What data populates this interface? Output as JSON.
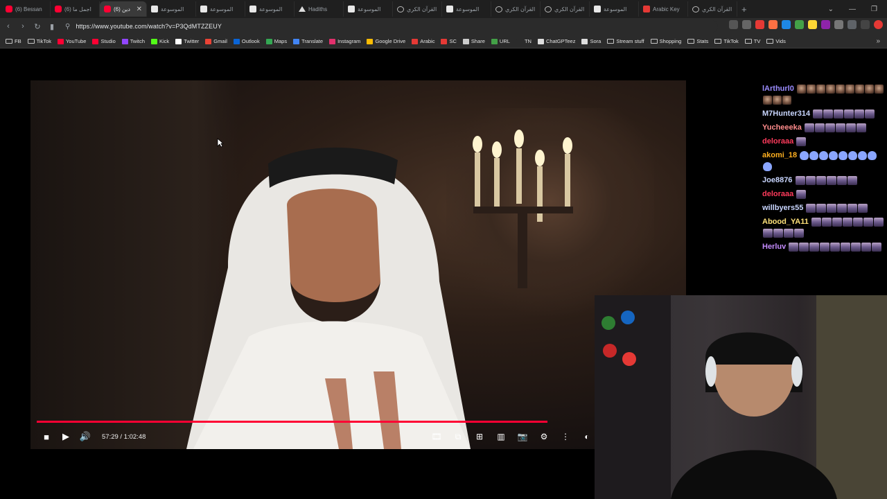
{
  "tabs": [
    {
      "label": "(6) Bessan",
      "icon": "youtube-icon"
    },
    {
      "label": "(6) اجمل ما",
      "icon": "youtube-icon"
    },
    {
      "label": "(6) دين",
      "icon": "youtube-icon",
      "active": true
    },
    {
      "label": "الموسوعة",
      "icon": "page-icon"
    },
    {
      "label": "الموسوعة",
      "icon": "page-icon"
    },
    {
      "label": "الموسوعة",
      "icon": "page-icon"
    },
    {
      "label": "Hadiths",
      "icon": "triangle-icon"
    },
    {
      "label": "الموسوعة",
      "icon": "page-icon"
    },
    {
      "label": "القرآن الكري",
      "icon": "globe-icon"
    },
    {
      "label": "الموسوعة",
      "icon": "page-icon"
    },
    {
      "label": "القرآن الكري",
      "icon": "globe-icon"
    },
    {
      "label": "القرآن الكري",
      "icon": "globe-icon"
    },
    {
      "label": "الموسوعة",
      "icon": "page-icon"
    },
    {
      "label": "Arabic Key",
      "icon": "arabic-icon"
    },
    {
      "label": "القرآن الكري",
      "icon": "globe-icon"
    }
  ],
  "new_tab": "+",
  "url": "https://www.youtube.com/watch?v=P3QdMTZZEUY",
  "bookmarks": [
    {
      "label": "FB",
      "icon": "folder-icon"
    },
    {
      "label": "TikTok",
      "icon": "folder-icon"
    },
    {
      "label": "YouTube",
      "icon": "youtube-icon",
      "color": "#ff0033"
    },
    {
      "label": "Studio",
      "icon": "youtube-studio-icon",
      "color": "#ff0033"
    },
    {
      "label": "Twitch",
      "icon": "twitch-icon",
      "color": "#9146ff"
    },
    {
      "label": "Kick",
      "icon": "kick-icon",
      "color": "#53fc18"
    },
    {
      "label": "Twitter",
      "icon": "x-icon",
      "color": "#ffffff"
    },
    {
      "label": "Gmail",
      "icon": "gmail-icon",
      "color": "#ea4335"
    },
    {
      "label": "Outlook",
      "icon": "outlook-icon",
      "color": "#0a64d6"
    },
    {
      "label": "Maps",
      "icon": "maps-icon",
      "color": "#34a853"
    },
    {
      "label": "Translate",
      "icon": "translate-icon",
      "color": "#4285f4"
    },
    {
      "label": "Instagram",
      "icon": "instagram-icon",
      "color": "#e1306c"
    },
    {
      "label": "Google Drive",
      "icon": "drive-icon",
      "color": "#fbbc04"
    },
    {
      "label": "Arabic",
      "icon": "arabic-icon",
      "color": "#e53935"
    },
    {
      "label": "SC",
      "icon": "sc-icon",
      "color": "#e53935"
    },
    {
      "label": "Share",
      "icon": "share-icon",
      "color": "#cccccc"
    },
    {
      "label": "URL",
      "icon": "url-icon",
      "color": "#43a047"
    },
    {
      "label": "TN",
      "icon": "none",
      "color": "#2b2b2b"
    },
    {
      "label": "ChatGPTeez",
      "icon": "chatgpt-icon",
      "color": "#dddddd"
    },
    {
      "label": "Sora",
      "icon": "sora-icon",
      "color": "#dddddd"
    },
    {
      "label": "Stream stuff",
      "icon": "folder-icon"
    },
    {
      "label": "Shopping",
      "icon": "folder-icon"
    },
    {
      "label": "Stats",
      "icon": "folder-icon"
    },
    {
      "label": "TikTok",
      "icon": "folder-icon"
    },
    {
      "label": "TV",
      "icon": "folder-icon"
    },
    {
      "label": "Vids",
      "icon": "folder-icon"
    }
  ],
  "player": {
    "time": "57:29 / 1:02:48",
    "progress": 0.915
  },
  "chat": [
    {
      "user": "lArthurl0",
      "color": "#9b8cff",
      "emotes": [
        "face",
        "face",
        "face",
        "face",
        "face",
        "face",
        "face",
        "face",
        "face",
        "face",
        "face",
        "face"
      ]
    },
    {
      "user": "M7Hunter314",
      "color": "#c9d6ff",
      "emotes": [
        "crowd",
        "crowd",
        "crowd",
        "crowd",
        "crowd",
        "crowd"
      ]
    },
    {
      "user": "Yucheeeka",
      "color": "#ff8c8c",
      "emotes": [
        "crowd",
        "crowd",
        "crowd",
        "crowd",
        "crowd",
        "crowd"
      ]
    },
    {
      "user": "deloraaa",
      "color": "#ff3b5c",
      "emotes": [
        "crowd"
      ]
    },
    {
      "user": "akomi_18",
      "color": "#ffb020",
      "emotes": [
        "ghost",
        "ghost",
        "ghost",
        "ghost",
        "ghost",
        "ghost",
        "ghost",
        "ghost",
        "ghost"
      ]
    },
    {
      "user": "Joe8876",
      "color": "#c9d6ff",
      "emotes": [
        "crowd",
        "crowd",
        "crowd",
        "crowd",
        "crowd",
        "crowd"
      ]
    },
    {
      "user": "deloraaa",
      "color": "#ff3b5c",
      "emotes": [
        "crowd"
      ]
    },
    {
      "user": "willbyers55",
      "color": "#c9d6ff",
      "emotes": [
        "crowd",
        "crowd",
        "crowd",
        "crowd",
        "crowd",
        "crowd"
      ]
    },
    {
      "user": "Abood_YA11",
      "color": "#ffe27a",
      "emotes": [
        "crowd",
        "crowd",
        "crowd",
        "crowd",
        "crowd",
        "crowd",
        "crowd",
        "crowd",
        "crowd",
        "crowd",
        "crowd"
      ]
    },
    {
      "user": "Herluv",
      "color": "#c58cff",
      "emotes": [
        "crowd",
        "crowd",
        "crowd",
        "crowd",
        "crowd",
        "crowd",
        "crowd",
        "crowd",
        "crowd"
      ]
    }
  ]
}
